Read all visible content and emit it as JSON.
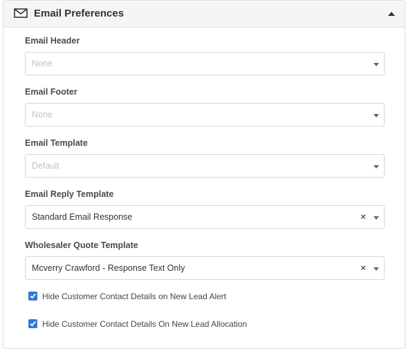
{
  "panel": {
    "title": "Email Preferences",
    "icon": "envelope-icon",
    "collapse_icon": "caret-up-icon"
  },
  "fields": [
    {
      "label": "Email Header",
      "value": "None",
      "placeholder": true,
      "clearable": false
    },
    {
      "label": "Email Footer",
      "value": "None",
      "placeholder": true,
      "clearable": false
    },
    {
      "label": "Email Template",
      "value": "Default",
      "placeholder": true,
      "clearable": false
    },
    {
      "label": "Email Reply Template",
      "value": "Standard Email Response",
      "placeholder": false,
      "clearable": true
    },
    {
      "label": "Wholesaler Quote Template",
      "value": "Mcverry Crawford - Response Text Only",
      "placeholder": false,
      "clearable": true
    }
  ],
  "clear_symbol": "×",
  "checkboxes": [
    {
      "label": "Hide Customer Contact Details on New Lead Alert",
      "checked": true
    },
    {
      "label": "Hide Customer Contact Details On New Lead Allocation",
      "checked": true
    }
  ],
  "colors": {
    "accent": "#2f7bd9",
    "header_bg": "#f5f5f5",
    "border": "#d6d6d6"
  }
}
